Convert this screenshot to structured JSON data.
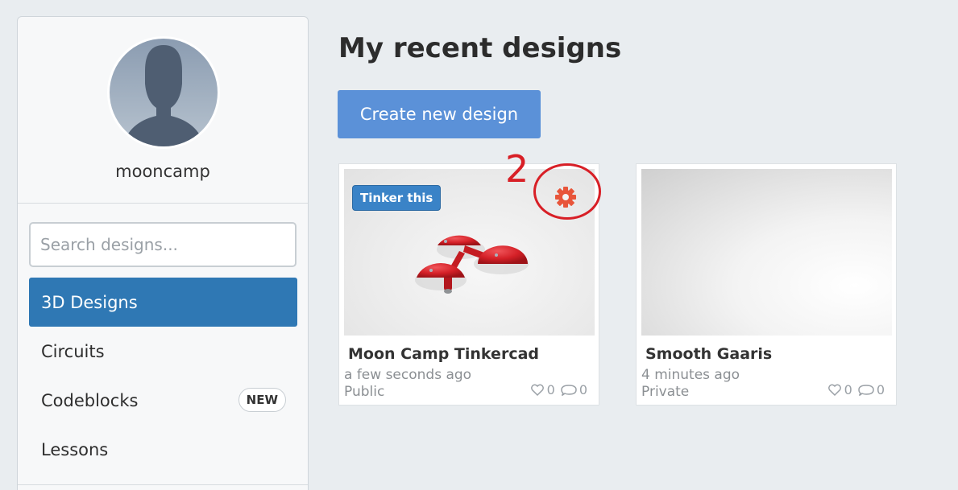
{
  "sidebar": {
    "username": "mooncamp",
    "search": {
      "placeholder": "Search designs..."
    },
    "nav": [
      {
        "label": "3D Designs",
        "active": true
      },
      {
        "label": "Circuits"
      },
      {
        "label": "Codeblocks",
        "badge": "NEW"
      },
      {
        "label": "Lessons"
      }
    ]
  },
  "main": {
    "title": "My recent designs",
    "create_button": "Create new design",
    "cards": [
      {
        "badge": "Tinker this",
        "title": "Moon Camp Tinkercad",
        "time": "a few seconds ago",
        "visibility": "Public",
        "likes": "0",
        "comments": "0"
      },
      {
        "title": "Smooth Gaaris",
        "time": "4 minutes ago",
        "visibility": "Private",
        "likes": "0",
        "comments": "0"
      }
    ]
  },
  "annotation": {
    "number": "2"
  },
  "colors": {
    "accent": "#2f78b4",
    "button": "#5b91d8",
    "gear": "#e8553a",
    "annotation": "#d81f26"
  }
}
